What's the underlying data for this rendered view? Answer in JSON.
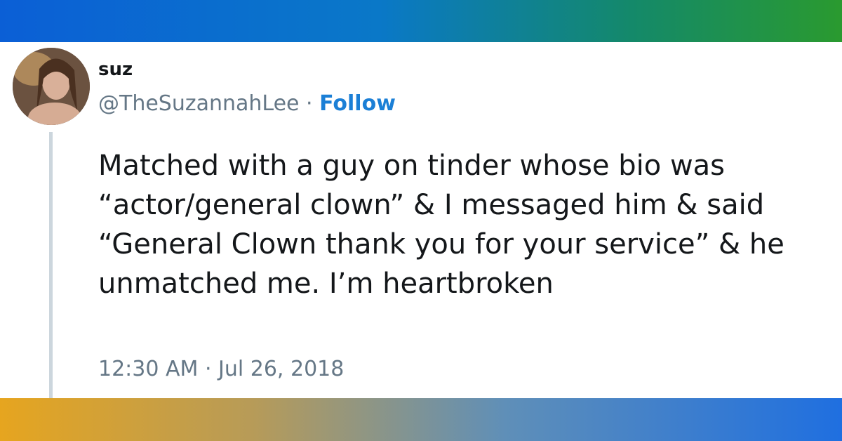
{
  "tweet": {
    "display_name": "suz",
    "handle": "@TheSuzannahLee",
    "separator": " · ",
    "follow_label": "Follow",
    "text": "Matched with a guy on tinder whose bio was “actor/general clown” & I messaged him & said “General Clown thank you for your service” & he unmatched me. I’m heartbroken",
    "time": "12:30 AM",
    "date_separator": " · ",
    "date": "Jul 26, 2018"
  },
  "colors": {
    "follow": "#1b7fd6",
    "meta_text": "#657786",
    "body_text": "#14171a"
  }
}
